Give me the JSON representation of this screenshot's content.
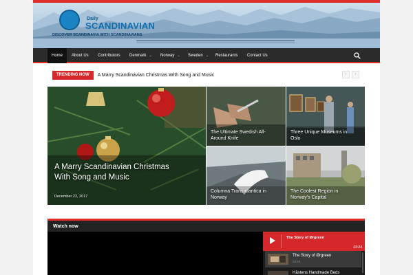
{
  "header": {
    "logo_small": "Daily",
    "logo_main": "SCANDINAVIAN",
    "logo_tagline": "DISCOVER SCANDINAVIA WITH SCANDINAVIANS"
  },
  "nav": {
    "items": [
      {
        "label": "Home",
        "active": true,
        "dropdown": false
      },
      {
        "label": "About Us",
        "dropdown": false
      },
      {
        "label": "Contributors",
        "dropdown": false
      },
      {
        "label": "Denmark",
        "dropdown": true
      },
      {
        "label": "Norway",
        "dropdown": true
      },
      {
        "label": "Sweden",
        "dropdown": true
      },
      {
        "label": "Restaurants",
        "dropdown": false
      },
      {
        "label": "Contact Us",
        "dropdown": false
      }
    ],
    "search_icon": "search-icon"
  },
  "trending": {
    "badge": "TRENDING NOW",
    "headline": "A Marry Scandinavian Christmas With Song and Music",
    "prev": "‹",
    "next": "›"
  },
  "featured": {
    "big": {
      "title": "A Marry Scandinavian Christmas With Song and Music",
      "date": "December 22, 2017"
    },
    "tiles": [
      {
        "title": "The Ultimate Swedish All-Around Knife"
      },
      {
        "title": "Three Unique Museums in Oslo"
      },
      {
        "title": "Columna Transatlantica in Norway"
      },
      {
        "title": "The Coolest Region in Norway's Capital"
      }
    ]
  },
  "watch": {
    "label": "Watch now",
    "now_playing": "The Story of Ørgreen",
    "now_time": "03:24",
    "playlist": [
      {
        "title": "The Story of Ørgreen",
        "duration": "03:24"
      },
      {
        "title": "Hästens Handmade Beds",
        "duration": ""
      }
    ]
  },
  "colors": {
    "accent": "#e22b2b",
    "nav_bg": "#2b2b2b"
  }
}
